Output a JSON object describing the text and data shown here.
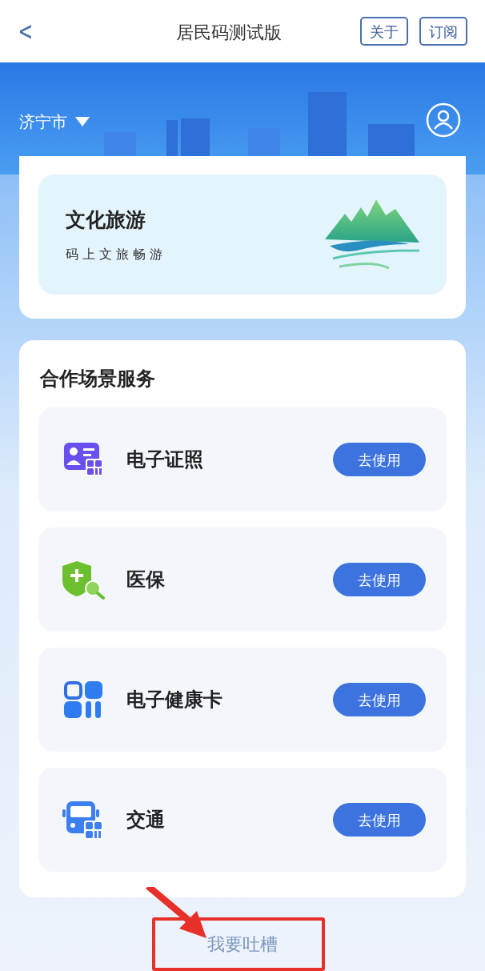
{
  "header": {
    "back": "<",
    "title": "居民码测试版",
    "buttons": [
      "关于",
      "订阅"
    ]
  },
  "location": {
    "city": "济宁市"
  },
  "feature_card": {
    "title": "文化旅游",
    "subtitle": "码上文旅畅游"
  },
  "services": {
    "title": "合作场景服务",
    "items": [
      {
        "kind": "license",
        "name": "电子证照",
        "action": "去使用"
      },
      {
        "kind": "insurance",
        "name": "医保",
        "action": "去使用"
      },
      {
        "kind": "health",
        "name": "电子健康卡",
        "action": "去使用"
      },
      {
        "kind": "transit",
        "name": "交通",
        "action": "去使用"
      }
    ]
  },
  "feedback": {
    "label": "我要吐槽",
    "highlighted": true
  }
}
